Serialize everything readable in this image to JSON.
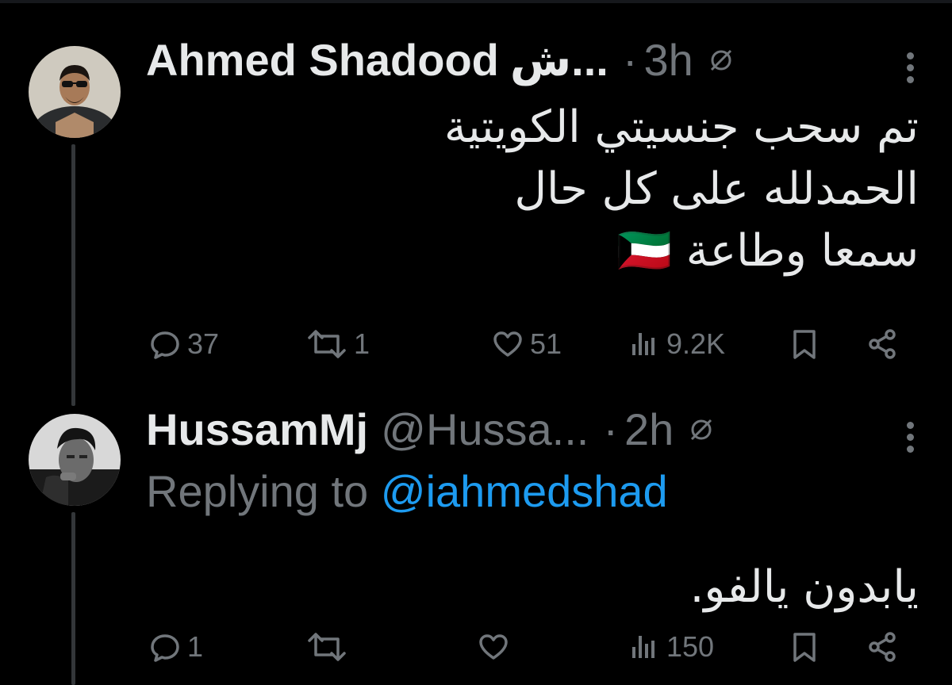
{
  "tweet1": {
    "name": "Ahmed Shadood",
    "name_suffix": "ش...",
    "time": "3h",
    "text_lines": [
      "تم سحب جنسيتي الكويتية",
      "الحمدلله على كل حال",
      "سمعا وطاعة 🇰🇼"
    ],
    "stats": {
      "replies": "37",
      "reposts": "1",
      "likes": "51",
      "views": "9.2K"
    }
  },
  "tweet2": {
    "name": "HussamMj",
    "handle": "@Hussa...",
    "time": "2h",
    "replying_prefix": "Replying to ",
    "replying_mention": "@iahmedshad",
    "text_lines": [
      "يابدون يالفو."
    ],
    "stats": {
      "replies": "1",
      "reposts": "",
      "likes": "",
      "views": "150"
    }
  },
  "separator": "·",
  "colors": {
    "background": "#000000",
    "text_primary": "#e7e9ea",
    "text_secondary": "#71767b",
    "link": "#1d9bf0",
    "thread_line": "#333639"
  },
  "icons": [
    "reply-icon",
    "repost-icon",
    "like-icon",
    "views-icon",
    "bookmark-icon",
    "share-icon",
    "globe-icon",
    "more-icon"
  ]
}
